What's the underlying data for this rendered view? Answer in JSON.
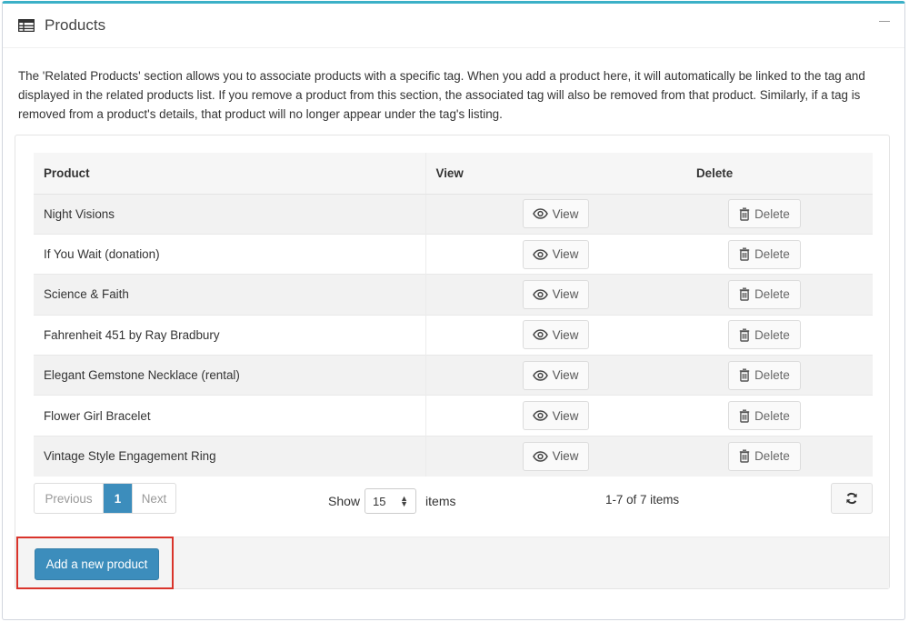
{
  "panel": {
    "title": "Products",
    "description": "The 'Related Products' section allows you to associate products with a specific tag. When you add a product here, it will automatically be linked to the tag and displayed in the related products list. If you remove a product from this section, the associated tag will also be removed from that product. Similarly, if a tag is removed from a product's details, that product will no longer appear under the tag's listing."
  },
  "table": {
    "headers": {
      "product": "Product",
      "view": "View",
      "delete": "Delete"
    },
    "view_label": "View",
    "delete_label": "Delete",
    "rows": [
      {
        "product": "Night Visions"
      },
      {
        "product": "If You Wait (donation)"
      },
      {
        "product": "Science & Faith"
      },
      {
        "product": "Fahrenheit 451 by Ray Bradbury"
      },
      {
        "product": "Elegant Gemstone Necklace (rental)"
      },
      {
        "product": "Flower Girl Bracelet"
      },
      {
        "product": "Vintage Style Engagement Ring"
      }
    ]
  },
  "pagination": {
    "previous": "Previous",
    "current_page": "1",
    "next": "Next",
    "show_label": "Show",
    "page_size": "15",
    "items_label": "items",
    "range": "1-7 of 7 items"
  },
  "actions": {
    "add_product": "Add a new product"
  },
  "colors": {
    "accent": "#3c8dbc",
    "panel_top_border": "#3bb0c7",
    "highlight_outline": "#d9342b"
  },
  "icons": {
    "panel": "table-icon",
    "view": "eye-icon",
    "delete": "trash-icon",
    "refresh": "refresh-icon",
    "collapse": "minus-icon"
  }
}
